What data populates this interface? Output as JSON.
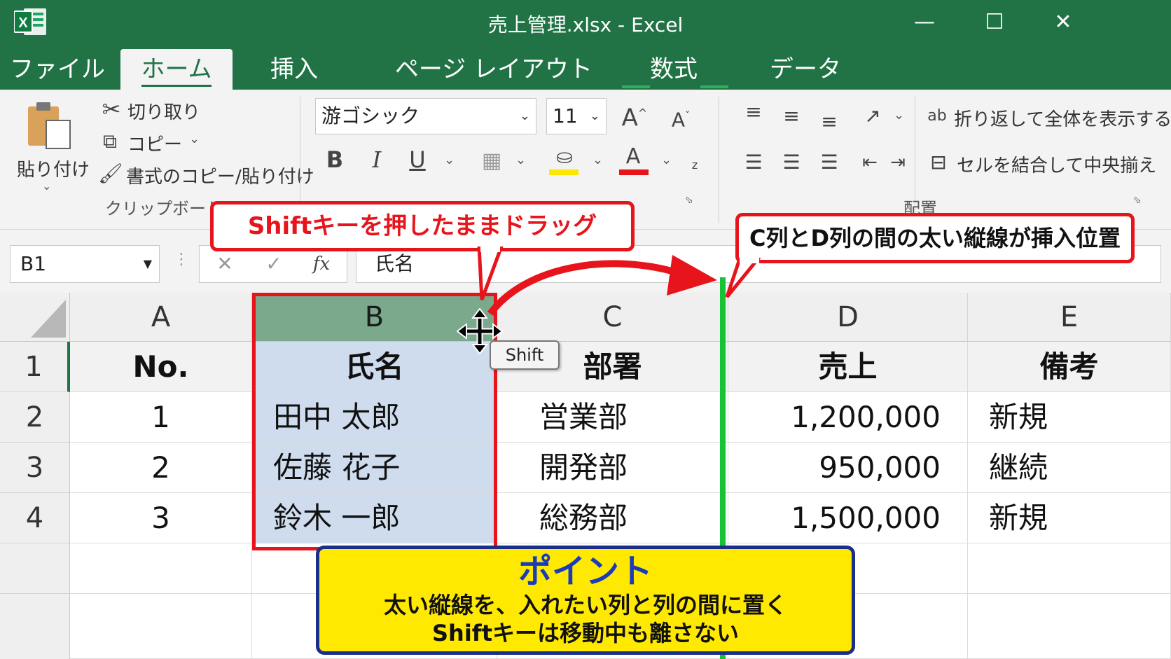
{
  "window": {
    "title": "売上管理.xlsx  -  Excel",
    "app_icon": "X",
    "minimize": "—",
    "maximize": "☐",
    "close": "✕"
  },
  "tabs": [
    "ファイル",
    "ホーム",
    "挿入",
    "ページ レイアウト",
    "数式",
    "データ"
  ],
  "active_tab": "ホーム",
  "ribbon": {
    "clipboard": {
      "paste": "貼り付け",
      "cut": "切り取り",
      "copy": "コピー",
      "format_painter": "書式のコピー/貼り付け",
      "group_label": "クリップボード"
    },
    "font": {
      "font_name": "游ゴシック",
      "font_size": "11",
      "increase": "A",
      "decrease": "A",
      "bold": "B",
      "italic": "I",
      "underline": "U",
      "font_color_letter": "A"
    },
    "alignment": {
      "wrap_text": "折り返して全体を表示する",
      "merge_center": "セルを結合して中央揃え",
      "group_label": "配置"
    }
  },
  "formula_bar": {
    "name_box": "B1",
    "cancel": "✕",
    "enter": "✓",
    "fx": "fx",
    "value": "氏名"
  },
  "sheet": {
    "columns": [
      "A",
      "B",
      "C",
      "D",
      "E"
    ],
    "rows": [
      "1",
      "2",
      "3",
      "4"
    ],
    "cells": [
      [
        "No.",
        "氏名",
        "部署",
        "売上",
        "備考"
      ],
      [
        "1",
        "田中  太郎",
        "営業部",
        "1,200,000",
        "新規"
      ],
      [
        "2",
        "佐藤  花子",
        "開発部",
        "950,000",
        "継続"
      ],
      [
        "3",
        "鈴木  一郎",
        "総務部",
        "1,500,000",
        "新規"
      ]
    ]
  },
  "annotations": {
    "drag_callout": "Shiftキーを押したままドラッグ",
    "insert_callout": "C列とD列の間の太い縦線が挿入位置",
    "shift_label": "Shift",
    "point_title": "ポイント",
    "point_line1": "太い縦線を、入れたい列と列の間に置く",
    "point_line2": "Shiftキーは移動中も離さない"
  },
  "colors": {
    "excel_green": "#217346",
    "selection_fill": "#cfdcee",
    "selected_header": "#7aa98c",
    "callout_red": "#e8141c",
    "insert_line": "#18c236",
    "point_yellow": "#ffe900",
    "point_blue": "#1a2f8c"
  }
}
